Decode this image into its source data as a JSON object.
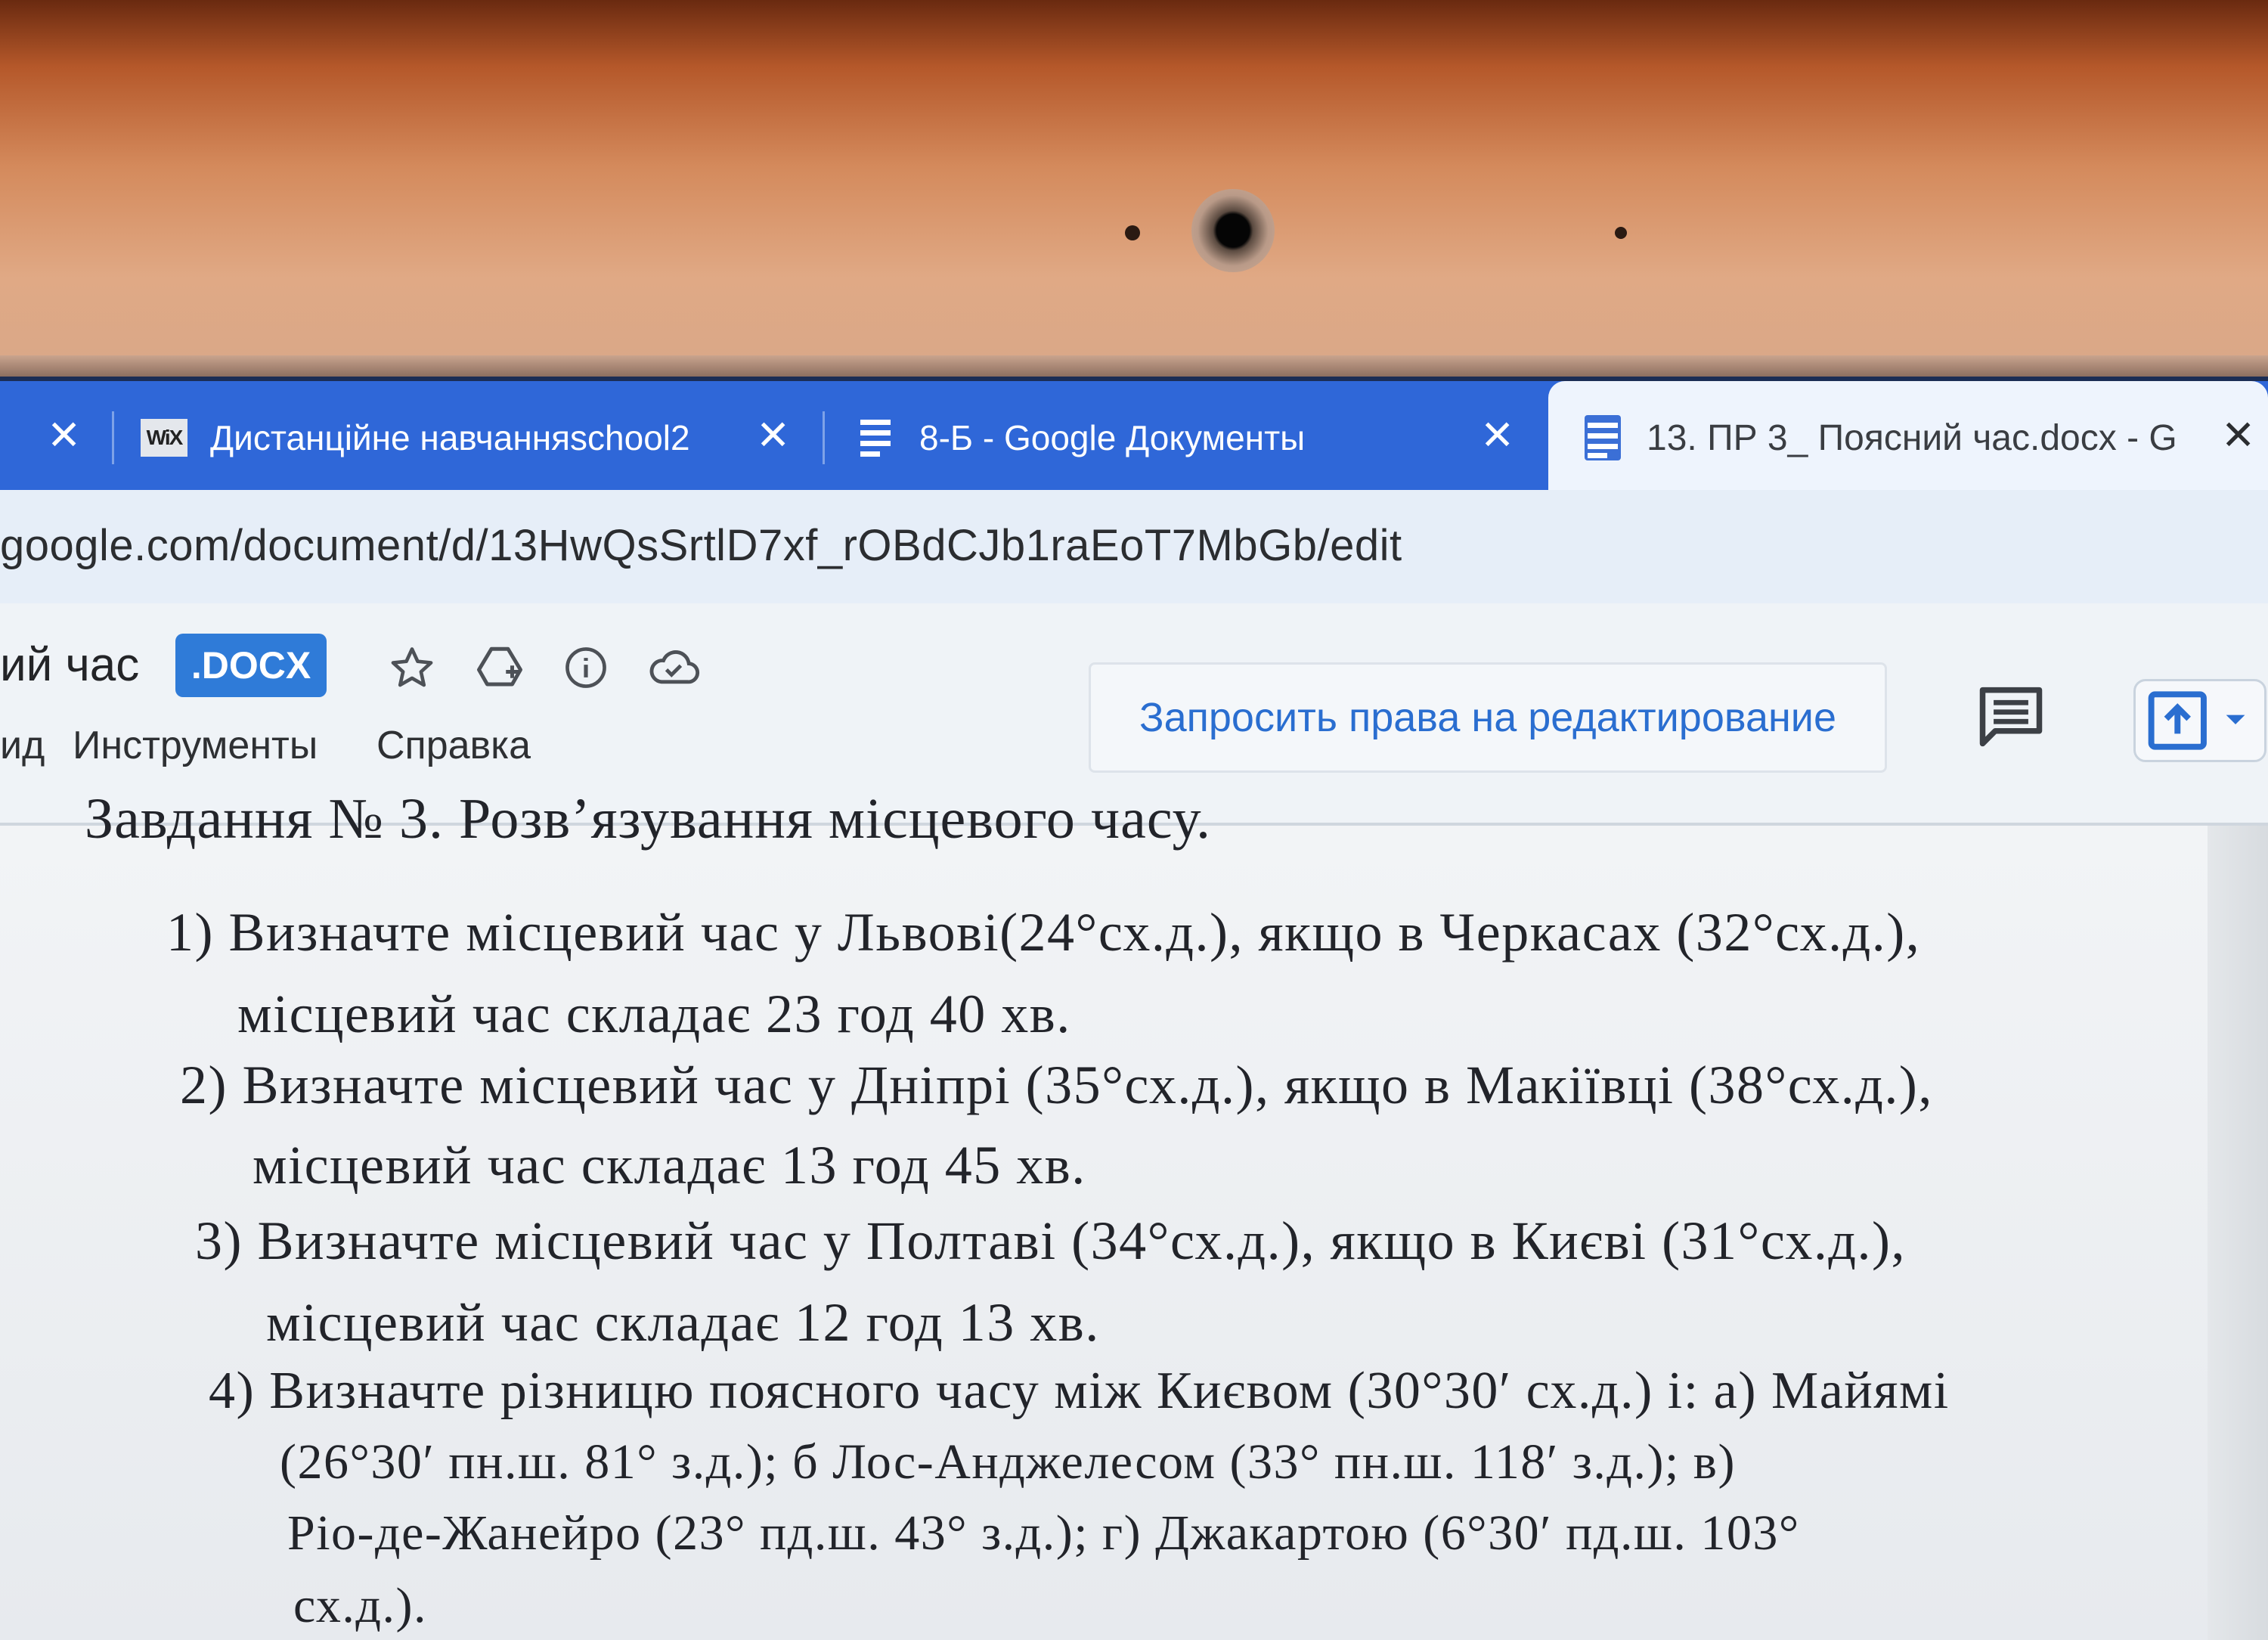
{
  "tabs": [
    {
      "label": "Дистанційне навчанняschool2",
      "icon": "wix-icon",
      "active": false
    },
    {
      "label": "8-Б - Google Документы",
      "icon": "docs-icon",
      "active": false
    },
    {
      "label": "13. ПР 3_ Поясний час.docx - G",
      "icon": "docs-icon",
      "active": true
    }
  ],
  "address": {
    "url": "google.com/document/d/13HwQsSrtlD7xf_rOBdCJb1raEoT7MbGb/edit"
  },
  "docs_toolbar": {
    "title_fragment": "ий час",
    "format_badge": ".DOCX",
    "menu": [
      "ид",
      "Инструменты",
      "Справка"
    ],
    "request_edit_label": "Запросить права на редактирование"
  },
  "document": {
    "heading": "Завдання № 3. Розв’язування місцевого часу.",
    "lines": [
      "1) Визначте місцевий час у Львові(24°сх.д.), якщо в Черкасах (32°сх.д.),",
      "місцевий час складає 23 год 40 хв.",
      "2)  Визначте місцевий час у Дніпрі (35°сх.д.), якщо в Макіївці (38°сх.д.),",
      "місцевий час складає 13 год 45 хв.",
      "3) Визначте місцевий час у Полтаві (34°сх.д.), якщо в Києві (31°сх.д.),",
      "місцевий час складає 12 год 13 хв.",
      "4) Визначте різницю поясного часу між Києвом (30°30′ сх.д.) і: а) Майямі",
      "(26°30′  пн.ш.  81°  з.д.);  б  Лос-Анджелесом  (33°  пн.ш.  118′  з.д.);  в)",
      "Ріо-де-Жанейро  (23°  пд.ш.  43°  з.д.);  г)  Джакартою  (6°30′  пд.ш.  103°",
      "сх.д.)."
    ]
  },
  "colors": {
    "tab_strip": "#2f67d8",
    "active_tab": "#eef4fd",
    "accent_link": "#2a6ed0",
    "docx_badge": "#2f7bd8"
  }
}
